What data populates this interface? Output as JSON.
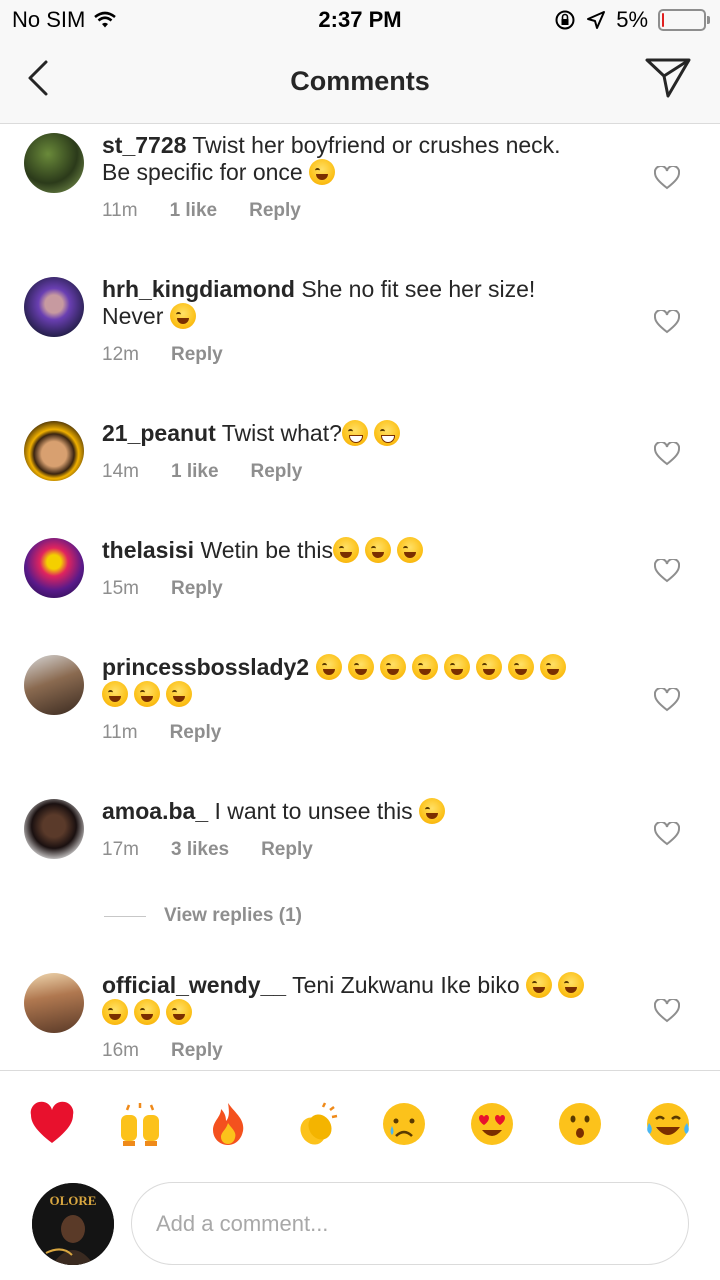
{
  "status_bar": {
    "carrier": "No SIM",
    "time": "2:37 PM",
    "battery_percent": "5%",
    "battery_level": 0.05,
    "icons": [
      "wifi-icon",
      "orientation-lock-icon",
      "location-arrow-icon",
      "battery-icon"
    ]
  },
  "header": {
    "title": "Comments",
    "back_icon": "chevron-left-icon",
    "send_icon": "paper-plane-icon"
  },
  "comments": [
    {
      "username": "st_7728",
      "text_lines": [
        "Twist her boyfriend or crushes neck.",
        "Be specific for once"
      ],
      "emojis_line": [
        0,
        1
      ],
      "time": "11m",
      "likes": "1 like",
      "reply": "Reply"
    },
    {
      "username": "hrh_kingdiamond",
      "text_lines": [
        "She no fit see her size!",
        "Never"
      ],
      "emojis_line": [
        0,
        1
      ],
      "time": "12m",
      "likes": "",
      "reply": "Reply"
    },
    {
      "username": "21_peanut",
      "text_lines": [
        "Twist what?"
      ],
      "emojis_line": [
        2,
        0
      ],
      "time": "14m",
      "likes": "1 like",
      "reply": "Reply"
    },
    {
      "username": "thelasisi",
      "text_lines": [
        "Wetin be this"
      ],
      "emojis_line": [
        3,
        0
      ],
      "time": "15m",
      "likes": "",
      "reply": "Reply"
    },
    {
      "username": "princessbosslady2",
      "text_lines": [
        ""
      ],
      "emojis_line": [
        8,
        3
      ],
      "time": "11m",
      "likes": "",
      "reply": "Reply"
    },
    {
      "username": "amoa.ba_",
      "text_lines": [
        "I want to unsee this"
      ],
      "emojis_line": [
        1,
        0
      ],
      "time": "17m",
      "likes": "3 likes",
      "reply": "Reply"
    },
    {
      "username": "official_wendy__",
      "text_lines": [
        "Teni Zukwanu Ike biko"
      ],
      "emojis_line": [
        2,
        3
      ],
      "time": "16m",
      "likes": "",
      "reply": "Reply"
    }
  ],
  "view_replies": "View replies (1)",
  "reactions": [
    "red-heart",
    "raising-hands",
    "fire",
    "clapping-hands",
    "crying-face",
    "heart-eyes",
    "hushed-face",
    "tears-of-joy"
  ],
  "composer": {
    "placeholder": "Add a comment...",
    "avatar_text": "OLORE"
  }
}
